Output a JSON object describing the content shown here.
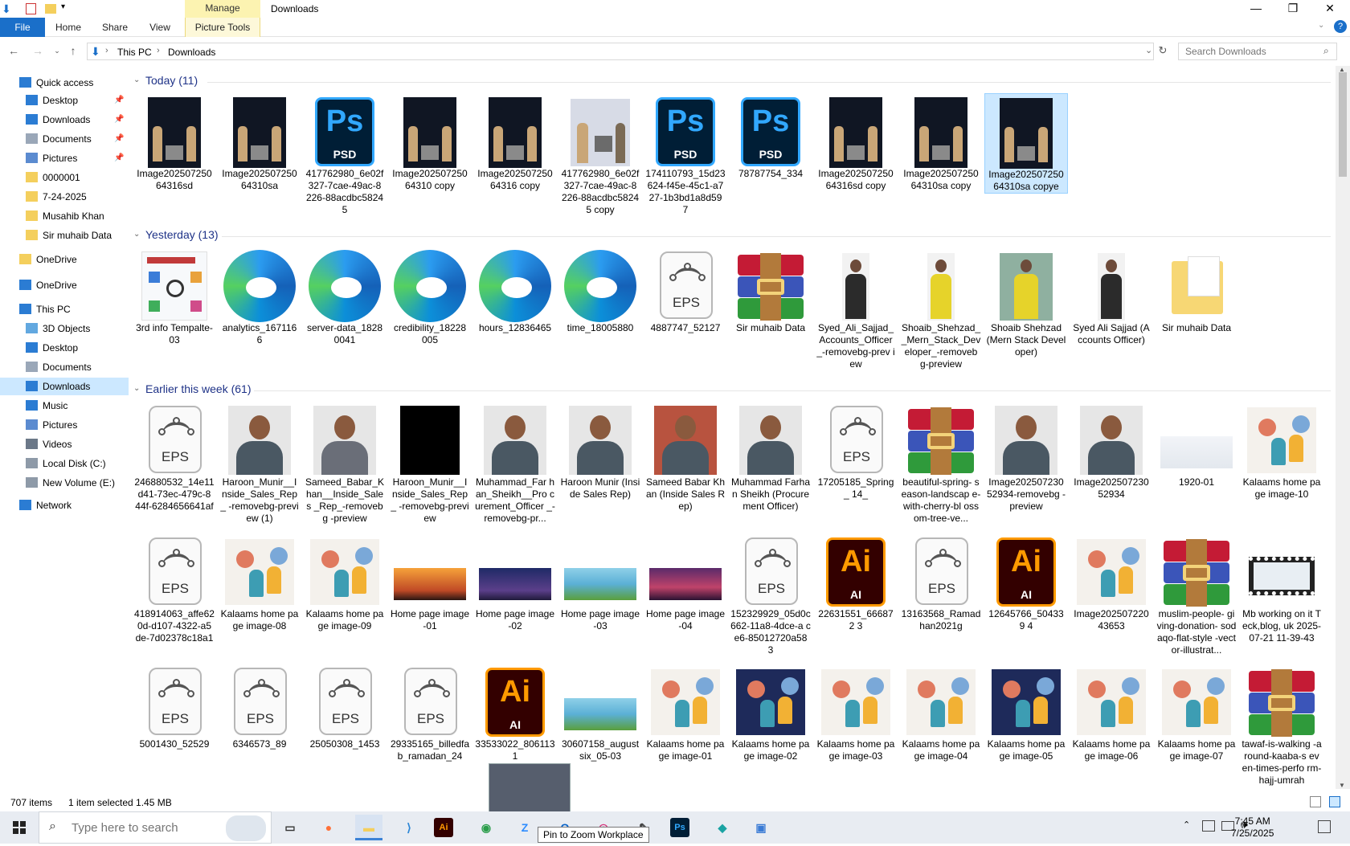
{
  "window": {
    "title": "Downloads",
    "manage_label": "Manage",
    "minimize": "—",
    "maximize": "❐",
    "close": "✕"
  },
  "ribbon": {
    "tabs": [
      "File",
      "Home",
      "Share",
      "View",
      "Picture Tools"
    ],
    "help": "?"
  },
  "address": {
    "crumbs": [
      "This PC",
      "Downloads"
    ],
    "search_placeholder": "Search Downloads"
  },
  "nav": {
    "items": [
      {
        "label": "Quick access",
        "icon": "star-icon"
      },
      {
        "label": "Desktop",
        "icon": "desktop-icon",
        "pinned": true
      },
      {
        "label": "Downloads",
        "icon": "download-icon",
        "pinned": true
      },
      {
        "label": "Documents",
        "icon": "documents-icon",
        "pinned": true
      },
      {
        "label": "Pictures",
        "icon": "pictures-icon",
        "pinned": true
      },
      {
        "label": "0000001",
        "icon": "folder-icon"
      },
      {
        "label": "7-24-2025",
        "icon": "folder-icon"
      },
      {
        "label": "Musahib Khan",
        "icon": "folder-icon"
      },
      {
        "label": "Sir muhaib Data",
        "icon": "folder-icon"
      },
      {
        "label": "OneDrive",
        "icon": "folder-icon"
      },
      {
        "label": "OneDrive",
        "icon": "cloud-icon"
      },
      {
        "label": "This PC",
        "icon": "pc-icon"
      },
      {
        "label": "3D Objects",
        "icon": "cube-icon"
      },
      {
        "label": "Desktop",
        "icon": "desktop-icon"
      },
      {
        "label": "Documents",
        "icon": "documents-icon"
      },
      {
        "label": "Downloads",
        "icon": "download-icon",
        "selected": true
      },
      {
        "label": "Music",
        "icon": "music-icon"
      },
      {
        "label": "Pictures",
        "icon": "pictures-icon"
      },
      {
        "label": "Videos",
        "icon": "videos-icon"
      },
      {
        "label": "Local Disk (C:)",
        "icon": "drive-icon"
      },
      {
        "label": "New Volume (E:)",
        "icon": "drive-icon"
      },
      {
        "label": "Network",
        "icon": "network-icon"
      }
    ]
  },
  "groups": [
    {
      "title": "Today (11)",
      "files": [
        {
          "name": "Image202507250 64316sd",
          "kind": "photo-dark"
        },
        {
          "name": "Image202507250 64310sa",
          "kind": "photo-dark"
        },
        {
          "name": "417762980_6e02f 327-7cae-49ac-8 226-88acdbc5824 5",
          "kind": "psd"
        },
        {
          "name": "Image202507250 64310 copy",
          "kind": "photo-dark"
        },
        {
          "name": "Image202507250 64316 copy",
          "kind": "photo-dark"
        },
        {
          "name": "417762980_6e02f 327-7cae-49ac-8 226-88acdbc5824 5 copy",
          "kind": "photo-light"
        },
        {
          "name": "174110793_15d23 624-f45e-45c1-a7 27-1b3bd1a8d59 7",
          "kind": "psd"
        },
        {
          "name": "78787754_334",
          "kind": "psd"
        },
        {
          "name": "Image202507250 64316sd copy",
          "kind": "photo-dark"
        },
        {
          "name": "Image202507250 64310sa copy",
          "kind": "photo-dark"
        },
        {
          "name": "Image202507250 64310sa copye",
          "kind": "photo-dark",
          "selected": true
        }
      ]
    },
    {
      "title": "Yesterday (13)",
      "files": [
        {
          "name": "3rd info Tempalte-03",
          "kind": "info"
        },
        {
          "name": "analytics_167116 6",
          "kind": "edge"
        },
        {
          "name": "server-data_1828 0041",
          "kind": "edge"
        },
        {
          "name": "credibility_18228 005",
          "kind": "edge"
        },
        {
          "name": "hours_12836465",
          "kind": "edge"
        },
        {
          "name": "time_18005880",
          "kind": "edge"
        },
        {
          "name": "4887747_52127",
          "kind": "eps"
        },
        {
          "name": "Sir muhaib Data",
          "kind": "rar"
        },
        {
          "name": "Syed_Ali_Sajjad_ Accounts_Officer _-removebg-prev iew",
          "kind": "person"
        },
        {
          "name": "Shoaib_Shehzad_ _Mern_Stack_Dev eloper_-removeb g-preview",
          "kind": "person-yellow"
        },
        {
          "name": "Shoaib Shehzad (Mern Stack Developer)",
          "kind": "person-yellow-bg"
        },
        {
          "name": "Syed Ali Sajjad (Accounts Officer)",
          "kind": "person"
        },
        {
          "name": "Sir muhaib Data",
          "kind": "folder"
        }
      ]
    },
    {
      "title": "Earlier this week (61)",
      "files": [
        {
          "name": "246880532_14e11 d41-73ec-479c-8 44f-6284656641af",
          "kind": "eps"
        },
        {
          "name": "Haroon_Munir__I nside_Sales_Rep_ -removebg-previ ew (1)",
          "kind": "portrait"
        },
        {
          "name": "Sameed_Babar_K han__Inside_Sales _Rep_-removebg -preview",
          "kind": "portrait-plaid"
        },
        {
          "name": "Haroon_Munir__I nside_Sales_Rep_ -removebg-previ ew",
          "kind": "black"
        },
        {
          "name": "Muhammad_Far han_Sheikh__Pro curement_Officer _-removebg-pr...",
          "kind": "portrait"
        },
        {
          "name": "Haroon Munir (Inside Sales Rep)",
          "kind": "portrait"
        },
        {
          "name": "Sameed Babar Khan (Inside Sales Rep)",
          "kind": "portrait-brick"
        },
        {
          "name": "Muhammad Farhan Sheikh (Procurement Officer)",
          "kind": "portrait"
        },
        {
          "name": "17205185_Spring_ 14_",
          "kind": "eps"
        },
        {
          "name": "beautiful-spring- season-landscap e-with-cherry-bl ossom-tree-ve...",
          "kind": "rar"
        },
        {
          "name": "Image202507230 52934-removebg -preview",
          "kind": "portrait"
        },
        {
          "name": "Image202507230 52934",
          "kind": "portrait"
        },
        {
          "name": "1920-01",
          "kind": "landscape-pale"
        },
        {
          "name": "Kalaams home page image-10",
          "kind": "illus"
        },
        {
          "name": "418914063_affe62 0d-d107-4322-a5 de-7d02378c18a1",
          "kind": "eps"
        },
        {
          "name": "Kalaams home page image-08",
          "kind": "illus"
        },
        {
          "name": "Kalaams home page image-09",
          "kind": "illus"
        },
        {
          "name": "Home page image-01",
          "kind": "landscape-sunset"
        },
        {
          "name": "Home page image-02",
          "kind": "landscape-night"
        },
        {
          "name": "Home page image-03",
          "kind": "landscape-green"
        },
        {
          "name": "Home page image-04",
          "kind": "landscape-dusk"
        },
        {
          "name": "152329929_05d0c 662-11a8-4dce-a ce6-85012720a58 3",
          "kind": "eps"
        },
        {
          "name": "22631551_666872 3",
          "kind": "ai"
        },
        {
          "name": "13163568_Ramad han2021g",
          "kind": "eps"
        },
        {
          "name": "12645766_504339 4",
          "kind": "ai"
        },
        {
          "name": "Image202507220 43653",
          "kind": "illus"
        },
        {
          "name": "muslim-people- giving-donation- sodaqo-flat-style -vector-illustrat...",
          "kind": "rar"
        },
        {
          "name": "Mb working on it Teck,blog, uk 2025-07-21 11-39-43",
          "kind": "video"
        },
        {
          "name": "5001430_52529",
          "kind": "eps"
        },
        {
          "name": "6346573_89",
          "kind": "eps"
        },
        {
          "name": "25050308_1453",
          "kind": "eps"
        },
        {
          "name": "29335165_billedfa b_ramadan_24",
          "kind": "eps"
        },
        {
          "name": "33533022_806113 1",
          "kind": "ai"
        },
        {
          "name": "30607158_august six_05-03",
          "kind": "landscape-green"
        },
        {
          "name": "Kalaams home page image-01",
          "kind": "illus"
        },
        {
          "name": "Kalaams home page image-02",
          "kind": "illus-night"
        },
        {
          "name": "Kalaams home page image-03",
          "kind": "illus"
        },
        {
          "name": "Kalaams home page image-04",
          "kind": "illus"
        },
        {
          "name": "Kalaams home page image-05",
          "kind": "illus-night"
        },
        {
          "name": "Kalaams home page image-06",
          "kind": "illus"
        },
        {
          "name": "Kalaams home page image-07",
          "kind": "illus"
        },
        {
          "name": "tawaf-is-walking -around-kaaba-s even-times-perfo rm-hajj-umrah",
          "kind": "rar"
        }
      ]
    }
  ],
  "status": {
    "count": "707 items",
    "selection": "1 item selected  1.45 MB"
  },
  "taskbar": {
    "search_placeholder": "Type here to search",
    "tooltip": "Pin to Zoom Workplace",
    "time": "7:45 AM",
    "date": "7/25/2025",
    "apps": [
      "task-view-icon",
      "firefox-icon",
      "file-explorer-icon",
      "vscode-icon",
      "illustrator-icon",
      "chrome-icon",
      "zoom-icon",
      "outlook-icon",
      "instagram-icon",
      "pen-icon",
      "photoshop-icon",
      "app-icon",
      "paint-icon"
    ]
  },
  "colors": {
    "accent": "#1a6fc9",
    "manage_tab": "#fcf3b1",
    "selection": "#cce8ff",
    "group_title": "#1e3287"
  }
}
